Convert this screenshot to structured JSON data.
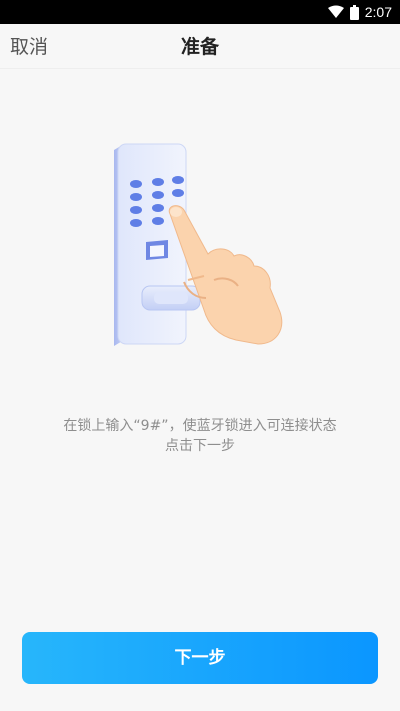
{
  "status_bar": {
    "time": "2:07",
    "icons": [
      "wifi-icon",
      "battery-icon"
    ]
  },
  "header": {
    "cancel_label": "取消",
    "title": "准备"
  },
  "illustration": {
    "icon": "smart-lock-with-hand-icon"
  },
  "instruction": {
    "line1": "在锁上输入“9#”，使蓝牙锁进入可连接状态",
    "line2": "点击下一步"
  },
  "footer": {
    "next_label": "下一步"
  },
  "colors": {
    "accent_start": "#27b6fb",
    "accent_end": "#0b96ff",
    "background": "#f7f7f7",
    "lock_body": "#e7ecfb",
    "keypad_dot": "#5f7ee6",
    "hand": "#fbd3ad"
  }
}
